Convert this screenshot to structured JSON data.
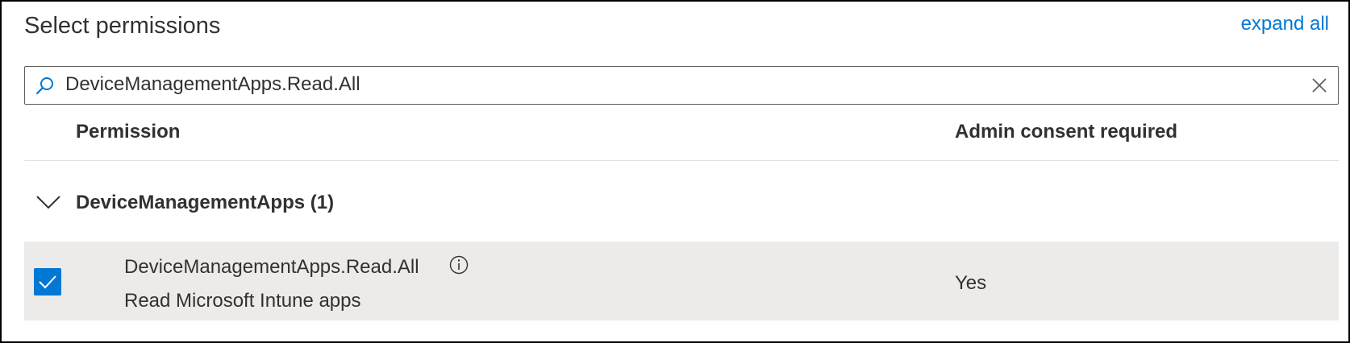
{
  "panel": {
    "title": "Select permissions",
    "expand_all_label": "expand all"
  },
  "search": {
    "value": "DeviceManagementApps.Read.All",
    "placeholder": "",
    "icon": "search-icon",
    "clear_icon": "close-icon"
  },
  "table": {
    "columns": [
      "Permission",
      "Admin consent required"
    ],
    "groups": [
      {
        "label": "DeviceManagementApps (1)",
        "expanded": true,
        "icon": "chevron-down-icon",
        "permissions": [
          {
            "name": "DeviceManagementApps.Read.All",
            "description": "Read Microsoft Intune apps",
            "admin_consent": "Yes",
            "checked": true,
            "info_icon": "info-icon"
          }
        ]
      }
    ]
  },
  "colors": {
    "accent": "#0078d4",
    "selected_row_background": "#edebe9",
    "text": "#323130"
  }
}
